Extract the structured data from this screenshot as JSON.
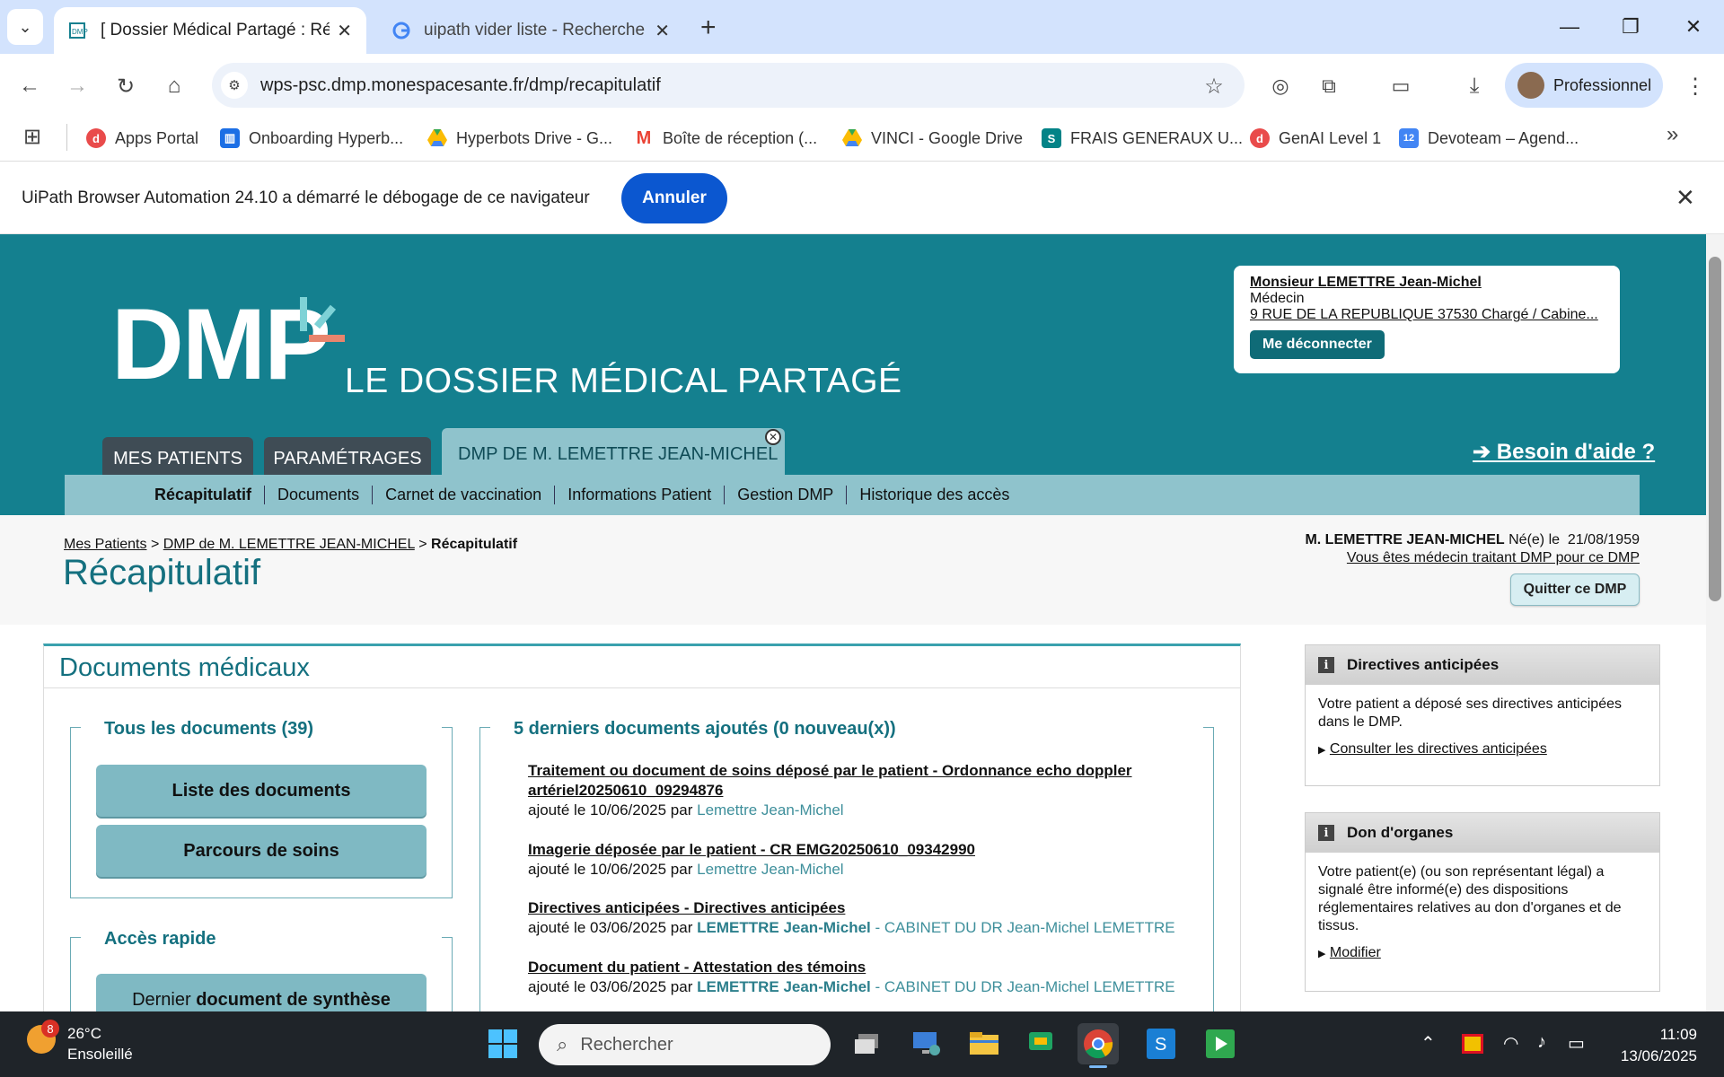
{
  "browser": {
    "tabs": [
      {
        "title": "[ Dossier Médical Partagé : Réca",
        "active": true
      },
      {
        "title": "uipath vider liste - Recherche G",
        "active": false
      }
    ],
    "new_tab": "+",
    "url_host": "wps-psc.dmp.monespacesante.fr",
    "url_path": "/dmp/recapitulatif",
    "profile_label": "Professionnel",
    "bookmarks": [
      {
        "label": "Apps Portal",
        "icon": "apps-portal-icon",
        "color": "#e94b4b"
      },
      {
        "label": "Onboarding Hyperb...",
        "icon": "trello-icon",
        "color": "#1c6fe5"
      },
      {
        "label": "Hyperbots Drive - G...",
        "icon": "google-drive-icon",
        "color": "#1fa463"
      },
      {
        "label": "Boîte de réception (...",
        "icon": "gmail-icon",
        "color": "#ea4335"
      },
      {
        "label": "VINCI - Google Drive",
        "icon": "google-drive-icon",
        "color": "#1fa463"
      },
      {
        "label": "FRAIS GENERAUX U...",
        "icon": "sharepoint-icon",
        "color": "#038387"
      },
      {
        "label": "GenAI Level 1",
        "icon": "genai-icon",
        "color": "#e94b4b"
      },
      {
        "label": "Devoteam – Agend...",
        "icon": "calendar-icon",
        "color": "#4285f4"
      }
    ],
    "infobar": {
      "message": "UiPath Browser Automation 24.10 a démarré le débogage de ce navigateur",
      "button": "Annuler"
    }
  },
  "site": {
    "logo_main": "DMP",
    "logo_sub": "LE DOSSIER MÉDICAL PARTAGÉ",
    "user": {
      "name": "Monsieur LEMETTRE Jean-Michel",
      "role": "Médecin",
      "address": "9 RUE DE LA REPUBLIQUE 37530 Chargé / Cabine...",
      "logout": "Me déconnecter"
    },
    "tabs": [
      "MES PATIENTS",
      "PARAMÉTRAGES",
      "DMP DE M. LEMETTRE JEAN-MICHEL"
    ],
    "help": "➔ Besoin d'aide ?",
    "subnav": [
      "Récapitulatif",
      "Documents",
      "Carnet de vaccination",
      "Informations Patient",
      "Gestion DMP",
      "Historique des accès"
    ],
    "breadcrumb": {
      "home": "Mes Patients",
      "sep": ">",
      "dmp": "DMP de M. LEMETTRE JEAN-MICHEL",
      "current": "Récapitulatif"
    },
    "page_title": "Récapitulatif",
    "patient": {
      "name": "M. LEMETTRE JEAN-MICHEL",
      "born_label": "Né(e) le",
      "born_date": "21/08/1959",
      "treating": "Vous êtes médecin traitant DMP pour ce DMP",
      "quit": "Quitter ce DMP"
    },
    "docs": {
      "title": "Documents médicaux",
      "all_title": "Tous les documents (39)",
      "btn_list": "Liste des documents",
      "btn_care": "Parcours de soins",
      "quick_title": "Accès rapide",
      "btn_synth_a": "Dernier",
      "btn_synth_b": "document de synthèse",
      "latest_title": "5 derniers documents ajoutés (0 nouveau(x))",
      "items": [
        {
          "title": "Traitement ou document de soins déposé par le patient - Ordonnance echo doppler artériel20250610_09294876",
          "added": "ajouté le 10/06/2025 par",
          "author": "Lemettre Jean-Michel",
          "org": ""
        },
        {
          "title": "Imagerie déposée par le patient - CR EMG20250610_09342990",
          "added": "ajouté le 10/06/2025 par",
          "author": "Lemettre Jean-Michel",
          "org": ""
        },
        {
          "title": "Directives anticipées - Directives anticipées",
          "added": "ajouté le 03/06/2025 par",
          "author": "LEMETTRE Jean-Michel",
          "org": "- CABINET DU DR Jean-Michel LEMETTRE"
        },
        {
          "title": "Document du patient - Attestation des témoins",
          "added": "ajouté le 03/06/2025 par",
          "author": "LEMETTRE Jean-Michel",
          "org": "- CABINET DU DR Jean-Michel LEMETTRE"
        }
      ]
    },
    "directives": {
      "title": "Directives anticipées",
      "text": "Votre patient a déposé ses directives anticipées dans le DMP.",
      "link": "Consulter les directives anticipées"
    },
    "organs": {
      "title": "Don d'organes",
      "text": "Votre patient(e) (ou son représentant légal) a signalé être informé(e) des dispositions réglementaires relatives au don d'organes et de tissus.",
      "link": "Modifier"
    }
  },
  "taskbar": {
    "weather_badge": "8",
    "temp": "26°C",
    "condition": "Ensoleillé",
    "search_placeholder": "Rechercher",
    "time": "11:09",
    "date": "13/06/2025"
  }
}
